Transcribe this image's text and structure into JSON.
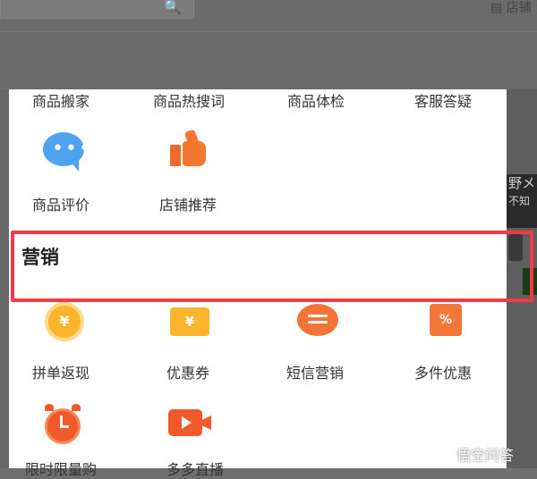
{
  "background": {
    "topright_text": "店铺"
  },
  "rows": {
    "row1": [
      "商品搬家",
      "商品热搜词",
      "商品体检",
      "客服答疑"
    ],
    "row2": [
      "商品评价",
      "店铺推荐"
    ],
    "section_title": "营销",
    "row3": [
      "拼单返现",
      "优惠券",
      "短信营销",
      "多件优惠"
    ],
    "row4": [
      "限时限量购",
      "多多直播"
    ]
  },
  "icons": {
    "coin_symbol": "¥",
    "ticket_symbol": "¥",
    "tag_symbol": "%"
  },
  "right_card": {
    "line1": "野メ",
    "line2": "不知"
  },
  "watermark": "悟空问答",
  "colors": {
    "highlight": "#f33a44",
    "accent_orange": "#f2772f",
    "accent_blue": "#4ea3f1",
    "accent_yellow": "#fbb52d"
  }
}
